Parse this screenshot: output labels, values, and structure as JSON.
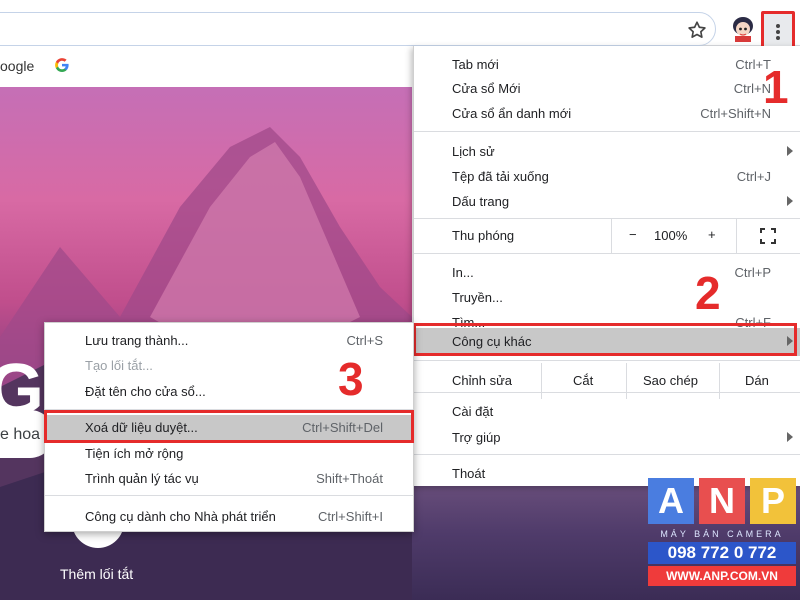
{
  "toolbar": {
    "bookmark_icon": "star-icon",
    "menu_icon": "kebab-menu-icon",
    "avatar_icon": "profile-avatar"
  },
  "page": {
    "google_text": "oogle",
    "google_logo": "Google",
    "search_partial": "e hoa",
    "shortcut_label": "Thêm lối tắt"
  },
  "main_menu": {
    "new_tab": {
      "label": "Tab mới",
      "shortcut": "Ctrl+T"
    },
    "new_window": {
      "label": "Cửa sổ Mới",
      "shortcut": "Ctrl+N"
    },
    "incognito": {
      "label": "Cửa sổ ẩn danh mới",
      "shortcut": "Ctrl+Shift+N"
    },
    "history": {
      "label": "Lịch sử"
    },
    "downloads": {
      "label": "Tệp đã tải xuống",
      "shortcut": "Ctrl+J"
    },
    "bookmarks": {
      "label": "Dấu trang"
    },
    "zoom": {
      "label": "Thu phóng",
      "minus": "−",
      "value": "100%",
      "plus": "+"
    },
    "print": {
      "label": "In...",
      "shortcut": "Ctrl+P"
    },
    "cast": {
      "label": "Truyền..."
    },
    "find": {
      "label": "Tìm...",
      "shortcut": "Ctrl+F"
    },
    "more_tools": {
      "label": "Công cụ khác"
    },
    "edit": {
      "label": "Chỉnh sửa",
      "cut": "Cắt",
      "copy": "Sao chép",
      "paste": "Dán"
    },
    "settings": {
      "label": "Cài đặt"
    },
    "help": {
      "label": "Trợ giúp"
    },
    "exit": {
      "label": "Thoát"
    }
  },
  "sub_menu": {
    "save_page": {
      "label": "Lưu trang thành...",
      "shortcut": "Ctrl+S"
    },
    "create_shortcut": {
      "label": "Tạo lối tắt..."
    },
    "name_window": {
      "label": "Đặt tên cho cửa sổ..."
    },
    "clear_data": {
      "label": "Xoá dữ liệu duyệt...",
      "shortcut": "Ctrl+Shift+Del"
    },
    "extensions": {
      "label": "Tiện ích mở rộng"
    },
    "task_manager": {
      "label": "Trình quản lý tác vụ",
      "shortcut": "Shift+Thoát"
    },
    "dev_tools": {
      "label": "Công cụ dành cho Nhà phát triển",
      "shortcut": "Ctrl+Shift+I"
    }
  },
  "steps": {
    "one": "1",
    "two": "2",
    "three": "3"
  },
  "watermark": {
    "letters": [
      "A",
      "N",
      "P"
    ],
    "tagline": "MÁY BÁN  CAMERA",
    "phone": "098 772 0 772",
    "site": "WWW.ANP.COM.VN"
  },
  "colors": {
    "highlight_border": "#e52b2b",
    "hover_bg": "#c8c8c8",
    "wm_tile_a": "#4a7de0",
    "wm_tile_n": "#e84f4f",
    "wm_tile_p": "#f2c23a"
  }
}
